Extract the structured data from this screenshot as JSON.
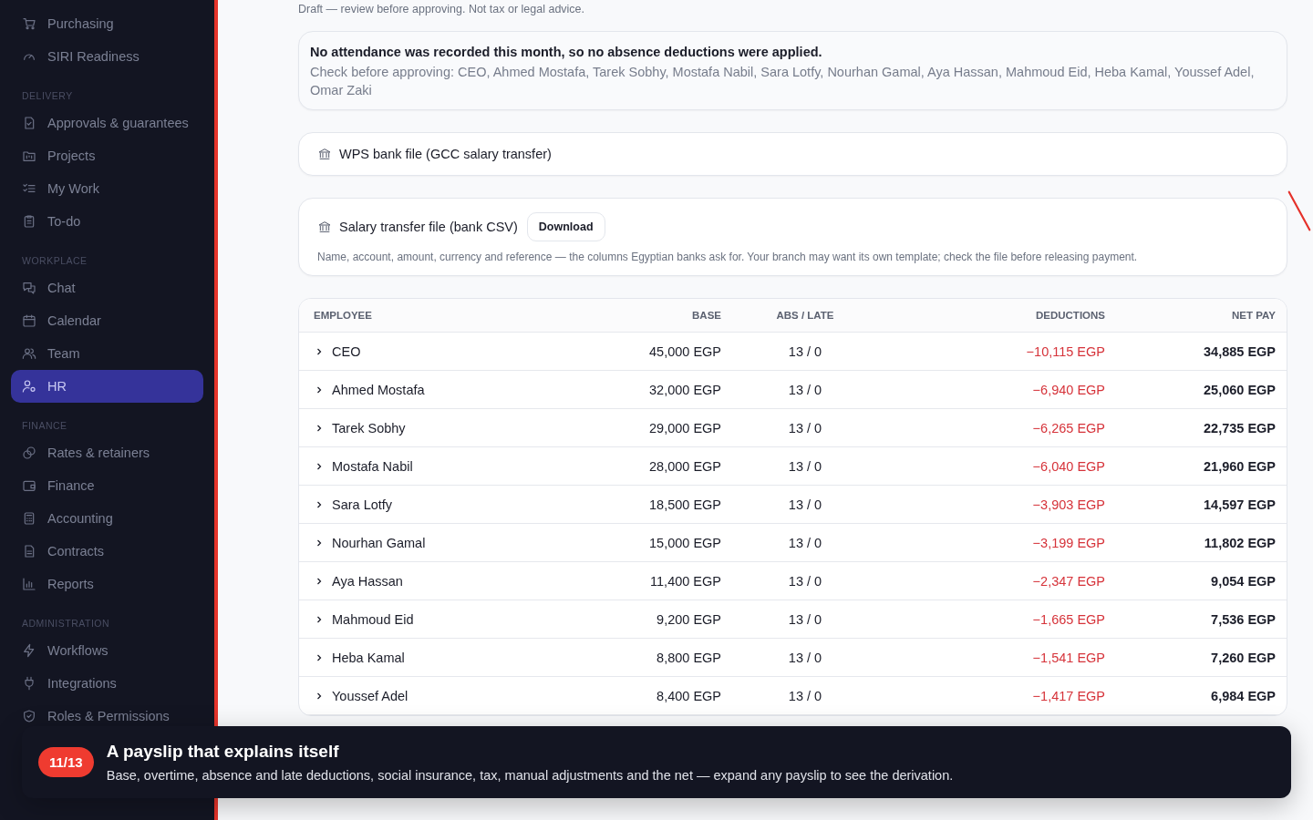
{
  "sidebar": {
    "sections": [
      {
        "items": [
          {
            "label": "Purchasing",
            "selected": false
          },
          {
            "label": "SIRI Readiness",
            "selected": false
          }
        ]
      },
      {
        "heading": "DELIVERY",
        "items": [
          {
            "label": "Approvals & guarantees",
            "selected": false
          },
          {
            "label": "Projects",
            "selected": false
          },
          {
            "label": "My Work",
            "selected": false
          },
          {
            "label": "To-do",
            "selected": false
          }
        ]
      },
      {
        "heading": "WORKPLACE",
        "items": [
          {
            "label": "Chat",
            "selected": false
          },
          {
            "label": "Calendar",
            "selected": false
          },
          {
            "label": "Team",
            "selected": false
          },
          {
            "label": "HR",
            "selected": true
          }
        ]
      },
      {
        "heading": "FINANCE",
        "items": [
          {
            "label": "Rates & retainers",
            "selected": false
          },
          {
            "label": "Finance",
            "selected": false
          },
          {
            "label": "Accounting",
            "selected": false
          },
          {
            "label": "Contracts",
            "selected": false
          },
          {
            "label": "Reports",
            "selected": false
          }
        ]
      },
      {
        "heading": "ADMINISTRATION",
        "items": [
          {
            "label": "Workflows",
            "selected": false
          },
          {
            "label": "Integrations",
            "selected": false
          },
          {
            "label": "Roles & Permissions",
            "selected": false
          }
        ]
      }
    ]
  },
  "draft_note": "Draft — review before approving. Not tax or legal advice.",
  "attendance_notice": {
    "title": "No attendance was recorded this month, so no absence deductions were applied.",
    "detail": "Check before approving: CEO, Ahmed Mostafa, Tarek Sobhy, Mostafa Nabil, Sara Lotfy, Nourhan Gamal, Aya Hassan, Mahmoud Eid, Heba Kamal, Youssef Adel, Omar Zaki"
  },
  "wps_file": {
    "title": "WPS bank file (GCC salary transfer)"
  },
  "csv_file": {
    "title": "Salary transfer file (bank CSV)",
    "button": "Download",
    "description": "Name, account, amount, currency and reference — the columns Egyptian banks ask for. Your branch may want its own template; check the file before releasing payment."
  },
  "table": {
    "columns": [
      "EMPLOYEE",
      "BASE",
      "ABS / LATE",
      "DEDUCTIONS",
      "NET PAY"
    ],
    "rows": [
      {
        "employee": "CEO",
        "base": "45,000 EGP",
        "abs_late": "13 / 0",
        "deductions": "−10,115 EGP",
        "net_pay": "34,885 EGP",
        "expanded": false
      },
      {
        "employee": "Ahmed Mostafa",
        "base": "32,000 EGP",
        "abs_late": "13 / 0",
        "deductions": "−6,940 EGP",
        "net_pay": "25,060 EGP",
        "expanded": false
      },
      {
        "employee": "Tarek Sobhy",
        "base": "29,000 EGP",
        "abs_late": "13 / 0",
        "deductions": "−6,265 EGP",
        "net_pay": "22,735 EGP",
        "expanded": false
      },
      {
        "employee": "Mostafa Nabil",
        "base": "28,000 EGP",
        "abs_late": "13 / 0",
        "deductions": "−6,040 EGP",
        "net_pay": "21,960 EGP",
        "expanded": false
      },
      {
        "employee": "Sara Lotfy",
        "base": "18,500 EGP",
        "abs_late": "13 / 0",
        "deductions": "−3,903 EGP",
        "net_pay": "14,597 EGP",
        "expanded": false
      },
      {
        "employee": "Nourhan Gamal",
        "base": "15,000 EGP",
        "abs_late": "13 / 0",
        "deductions": "−3,199 EGP",
        "net_pay": "11,802 EGP",
        "expanded": false
      },
      {
        "employee": "Aya Hassan",
        "base": "11,400 EGP",
        "abs_late": "13 / 0",
        "deductions": "−2,347 EGP",
        "net_pay": "9,054 EGP",
        "expanded": false
      },
      {
        "employee": "Mahmoud Eid",
        "base": "9,200 EGP",
        "abs_late": "13 / 0",
        "deductions": "−1,665 EGP",
        "net_pay": "7,536 EGP",
        "expanded": false
      },
      {
        "employee": "Heba Kamal",
        "base": "8,800 EGP",
        "abs_late": "13 / 0",
        "deductions": "−1,541 EGP",
        "net_pay": "7,260 EGP",
        "expanded": false
      },
      {
        "employee": "Youssef Adel",
        "base": "8,400 EGP",
        "abs_late": "13 / 0",
        "deductions": "−1,417 EGP",
        "net_pay": "6,984 EGP",
        "expanded": false
      }
    ]
  },
  "tour": {
    "step": "11/13",
    "title": "A payslip that explains itself",
    "text": "Base, overtime, absence and late deductions, social insurance, tax, manual adjustments and the net — expand any payslip to see the derivation."
  }
}
